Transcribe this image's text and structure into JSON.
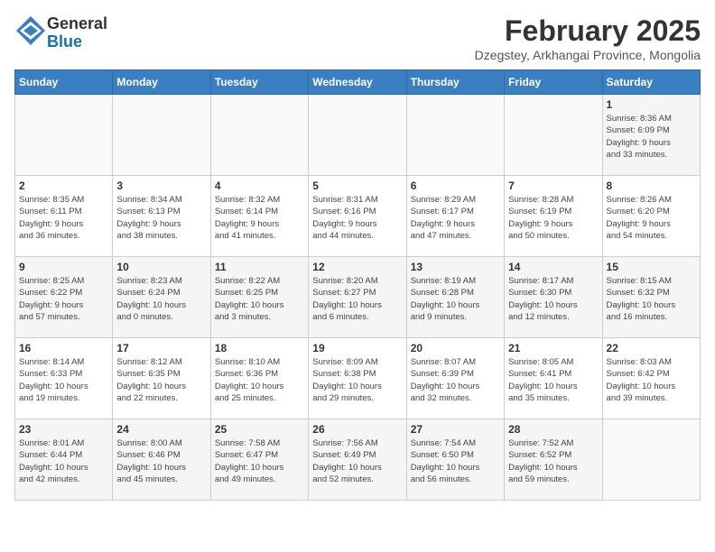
{
  "header": {
    "logo_line1": "General",
    "logo_line2": "Blue",
    "month": "February 2025",
    "location": "Dzegstey, Arkhangai Province, Mongolia"
  },
  "days_of_week": [
    "Sunday",
    "Monday",
    "Tuesday",
    "Wednesday",
    "Thursday",
    "Friday",
    "Saturday"
  ],
  "weeks": [
    [
      {
        "day": "",
        "info": ""
      },
      {
        "day": "",
        "info": ""
      },
      {
        "day": "",
        "info": ""
      },
      {
        "day": "",
        "info": ""
      },
      {
        "day": "",
        "info": ""
      },
      {
        "day": "",
        "info": ""
      },
      {
        "day": "1",
        "info": "Sunrise: 8:36 AM\nSunset: 6:09 PM\nDaylight: 9 hours\nand 33 minutes."
      }
    ],
    [
      {
        "day": "2",
        "info": "Sunrise: 8:35 AM\nSunset: 6:11 PM\nDaylight: 9 hours\nand 36 minutes."
      },
      {
        "day": "3",
        "info": "Sunrise: 8:34 AM\nSunset: 6:13 PM\nDaylight: 9 hours\nand 38 minutes."
      },
      {
        "day": "4",
        "info": "Sunrise: 8:32 AM\nSunset: 6:14 PM\nDaylight: 9 hours\nand 41 minutes."
      },
      {
        "day": "5",
        "info": "Sunrise: 8:31 AM\nSunset: 6:16 PM\nDaylight: 9 hours\nand 44 minutes."
      },
      {
        "day": "6",
        "info": "Sunrise: 8:29 AM\nSunset: 6:17 PM\nDaylight: 9 hours\nand 47 minutes."
      },
      {
        "day": "7",
        "info": "Sunrise: 8:28 AM\nSunset: 6:19 PM\nDaylight: 9 hours\nand 50 minutes."
      },
      {
        "day": "8",
        "info": "Sunrise: 8:26 AM\nSunset: 6:20 PM\nDaylight: 9 hours\nand 54 minutes."
      }
    ],
    [
      {
        "day": "9",
        "info": "Sunrise: 8:25 AM\nSunset: 6:22 PM\nDaylight: 9 hours\nand 57 minutes."
      },
      {
        "day": "10",
        "info": "Sunrise: 8:23 AM\nSunset: 6:24 PM\nDaylight: 10 hours\nand 0 minutes."
      },
      {
        "day": "11",
        "info": "Sunrise: 8:22 AM\nSunset: 6:25 PM\nDaylight: 10 hours\nand 3 minutes."
      },
      {
        "day": "12",
        "info": "Sunrise: 8:20 AM\nSunset: 6:27 PM\nDaylight: 10 hours\nand 6 minutes."
      },
      {
        "day": "13",
        "info": "Sunrise: 8:19 AM\nSunset: 6:28 PM\nDaylight: 10 hours\nand 9 minutes."
      },
      {
        "day": "14",
        "info": "Sunrise: 8:17 AM\nSunset: 6:30 PM\nDaylight: 10 hours\nand 12 minutes."
      },
      {
        "day": "15",
        "info": "Sunrise: 8:15 AM\nSunset: 6:32 PM\nDaylight: 10 hours\nand 16 minutes."
      }
    ],
    [
      {
        "day": "16",
        "info": "Sunrise: 8:14 AM\nSunset: 6:33 PM\nDaylight: 10 hours\nand 19 minutes."
      },
      {
        "day": "17",
        "info": "Sunrise: 8:12 AM\nSunset: 6:35 PM\nDaylight: 10 hours\nand 22 minutes."
      },
      {
        "day": "18",
        "info": "Sunrise: 8:10 AM\nSunset: 6:36 PM\nDaylight: 10 hours\nand 25 minutes."
      },
      {
        "day": "19",
        "info": "Sunrise: 8:09 AM\nSunset: 6:38 PM\nDaylight: 10 hours\nand 29 minutes."
      },
      {
        "day": "20",
        "info": "Sunrise: 8:07 AM\nSunset: 6:39 PM\nDaylight: 10 hours\nand 32 minutes."
      },
      {
        "day": "21",
        "info": "Sunrise: 8:05 AM\nSunset: 6:41 PM\nDaylight: 10 hours\nand 35 minutes."
      },
      {
        "day": "22",
        "info": "Sunrise: 8:03 AM\nSunset: 6:42 PM\nDaylight: 10 hours\nand 39 minutes."
      }
    ],
    [
      {
        "day": "23",
        "info": "Sunrise: 8:01 AM\nSunset: 6:44 PM\nDaylight: 10 hours\nand 42 minutes."
      },
      {
        "day": "24",
        "info": "Sunrise: 8:00 AM\nSunset: 6:46 PM\nDaylight: 10 hours\nand 45 minutes."
      },
      {
        "day": "25",
        "info": "Sunrise: 7:58 AM\nSunset: 6:47 PM\nDaylight: 10 hours\nand 49 minutes."
      },
      {
        "day": "26",
        "info": "Sunrise: 7:56 AM\nSunset: 6:49 PM\nDaylight: 10 hours\nand 52 minutes."
      },
      {
        "day": "27",
        "info": "Sunrise: 7:54 AM\nSunset: 6:50 PM\nDaylight: 10 hours\nand 56 minutes."
      },
      {
        "day": "28",
        "info": "Sunrise: 7:52 AM\nSunset: 6:52 PM\nDaylight: 10 hours\nand 59 minutes."
      },
      {
        "day": "",
        "info": ""
      }
    ]
  ]
}
